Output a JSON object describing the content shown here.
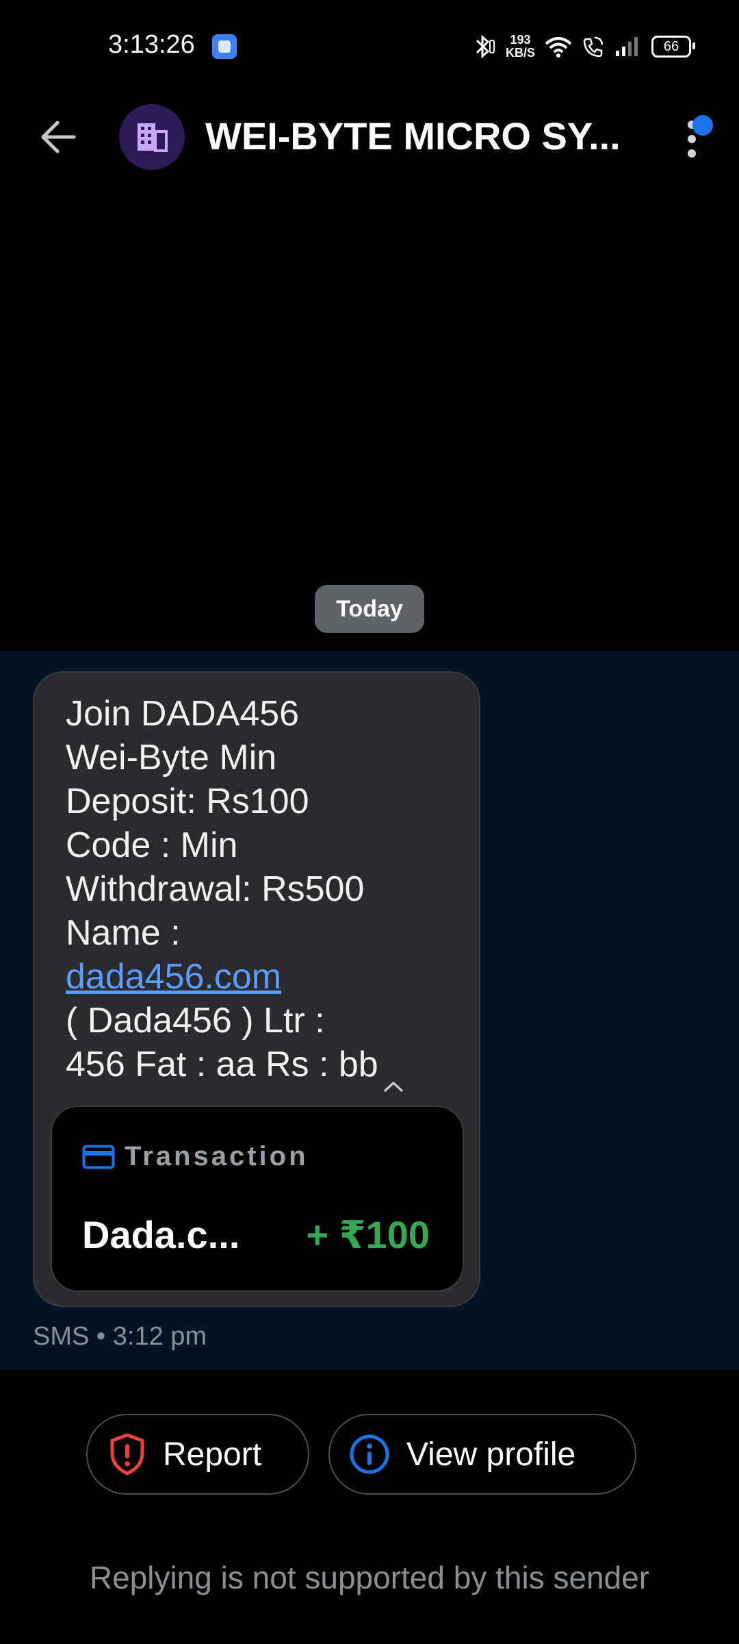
{
  "status_bar": {
    "time": "3:13:26",
    "net_speed_value": "193",
    "net_speed_unit": "KB/S",
    "battery": "66"
  },
  "header": {
    "title": "WEI-BYTE MICRO SY..."
  },
  "conversation": {
    "date_chip": "Today",
    "message_lines": [
      "Join DADA456",
      "Wei-Byte Min",
      "Deposit: Rs100",
      "Code : Min",
      "Withdrawal: Rs500",
      "Name :",
      "dada456.com",
      "( Dada456 ) Ltr :",
      "456 Fat  : aa Rs : bb"
    ],
    "transaction": {
      "label": "Transaction",
      "merchant": "Dada.c...",
      "amount": "+ ₹100"
    },
    "meta": "SMS • 3:12 pm"
  },
  "actions": {
    "report_label": "Report",
    "view_profile_label": "View profile"
  },
  "footer": {
    "reply_note": "Replying is not supported by this sender"
  },
  "colors": {
    "link": "#5b9cff",
    "amount_positive": "#34a853",
    "accent_blue": "#1a73e8",
    "report_red": "#ea4335"
  }
}
